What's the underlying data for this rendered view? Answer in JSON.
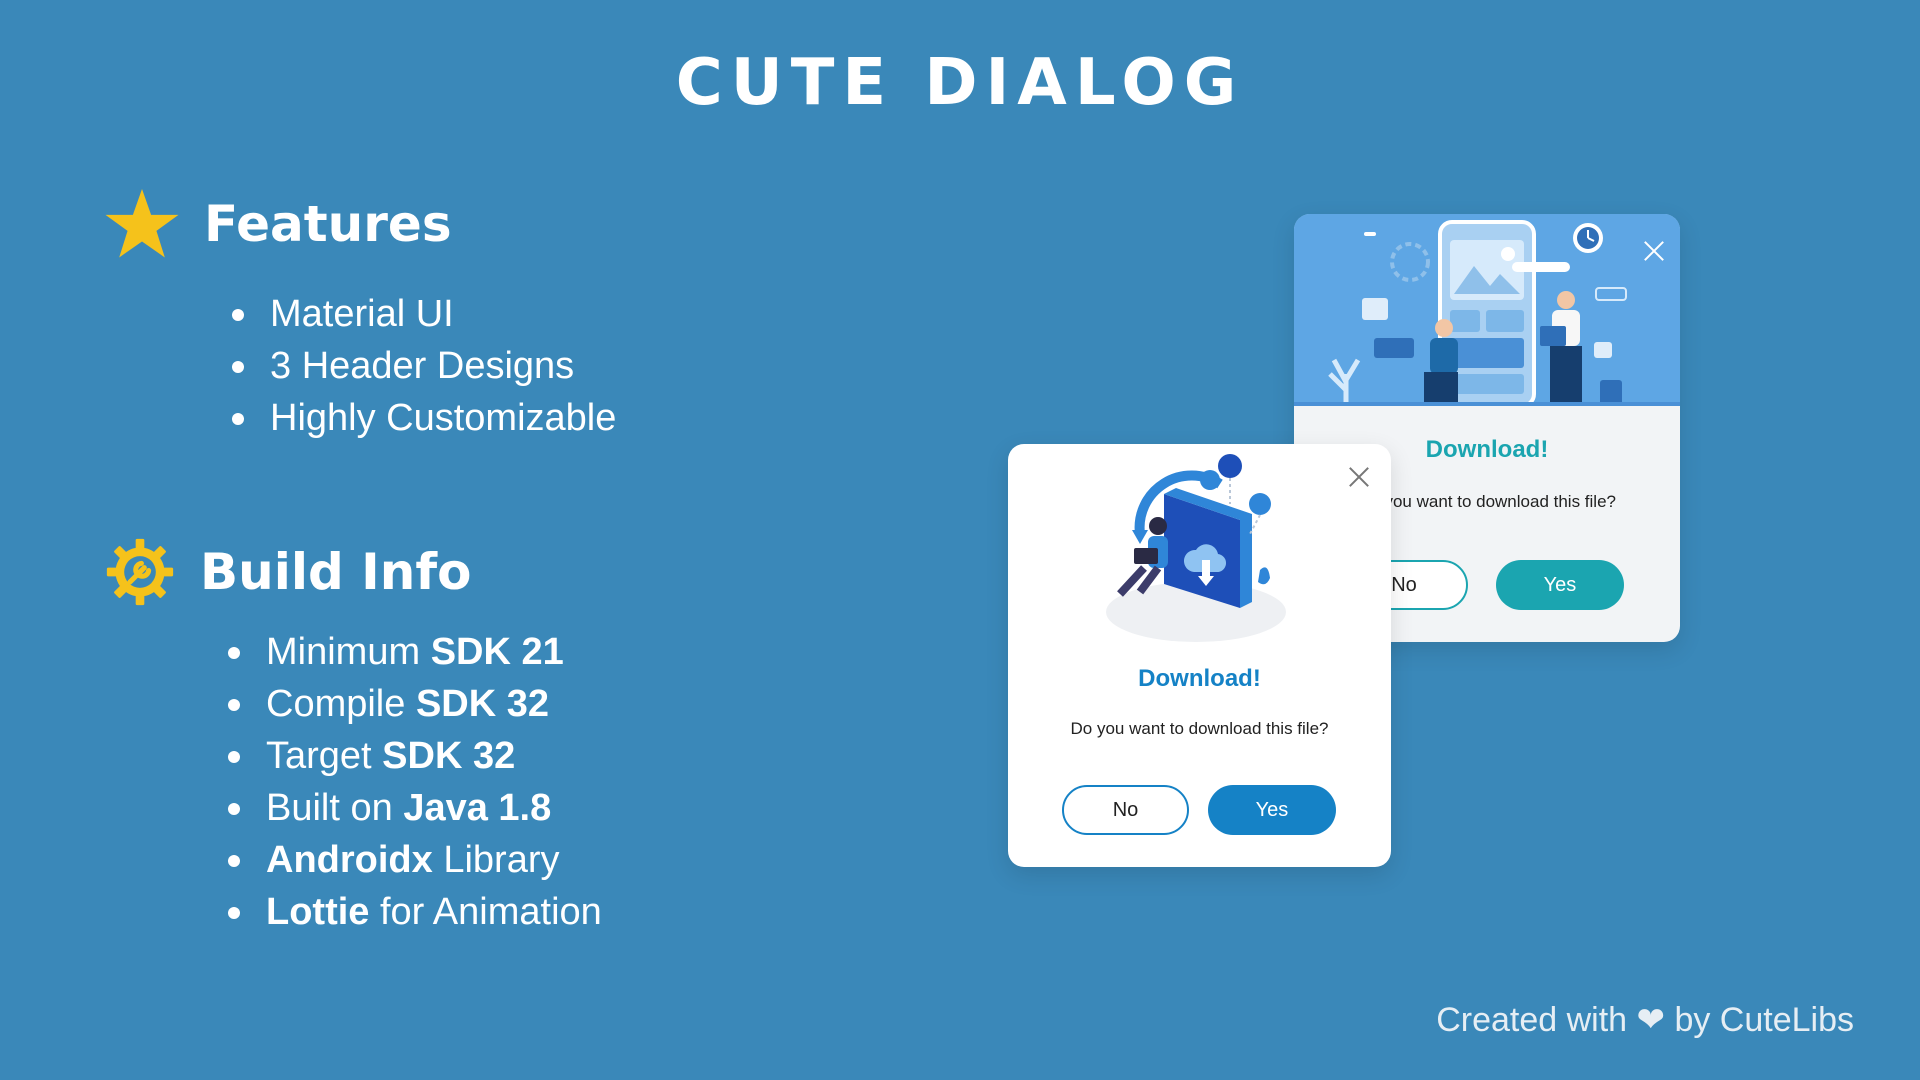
{
  "title": "CUTE DIALOG",
  "features": {
    "heading": "Features",
    "items": [
      "Material UI",
      "3 Header Designs",
      "Highly Customizable"
    ]
  },
  "build_info": {
    "heading": "Build Info",
    "items": [
      {
        "normal_before": "Minimum ",
        "bold": "SDK 21",
        "normal_after": ""
      },
      {
        "normal_before": "Compile ",
        "bold": "SDK 32",
        "normal_after": ""
      },
      {
        "normal_before": "Target ",
        "bold": "SDK 32",
        "normal_after": ""
      },
      {
        "normal_before": "Built on ",
        "bold": "Java 1.8",
        "normal_after": ""
      },
      {
        "normal_before": "",
        "bold": "Androidx",
        "normal_after": " Library"
      },
      {
        "normal_before": "",
        "bold": "Lottie",
        "normal_after": " for Animation"
      }
    ]
  },
  "dialog_back": {
    "title": "Download!",
    "message": "Do you want to download this file?",
    "no_label": "No",
    "yes_label": "Yes",
    "accent": "#1BA5B0"
  },
  "dialog_front": {
    "title": "Download!",
    "message": "Do you want to download this file?",
    "no_label": "No",
    "yes_label": "Yes",
    "accent": "#1582C6"
  },
  "footer": "Created with ❤ by CuteLibs",
  "colors": {
    "background": "#3A88B9",
    "star": "#F5C21B",
    "gear": "#F5C21B"
  },
  "icons": [
    "star-icon",
    "gear-icon",
    "close-icon",
    "illustration-header",
    "illustration-download"
  ]
}
